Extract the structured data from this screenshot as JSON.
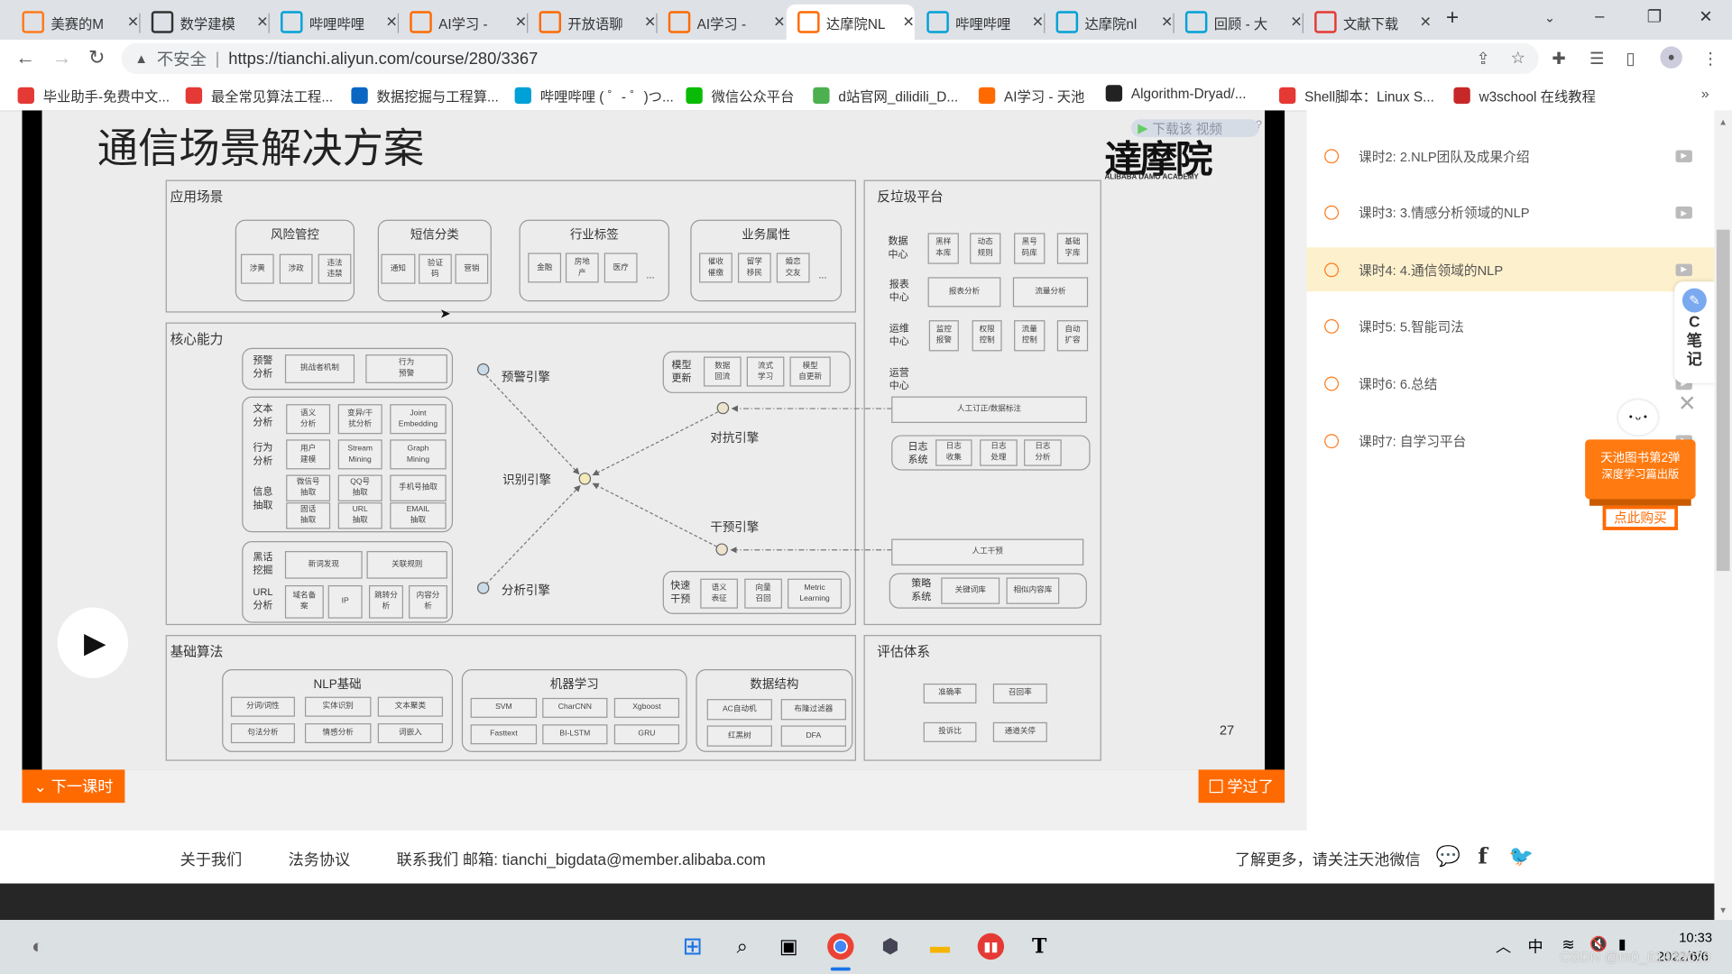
{
  "tabs": [
    {
      "label": "美赛的M",
      "icon": "sogou-icon",
      "color": "#ff7a1a"
    },
    {
      "label": "数学建模",
      "icon": "zhihu-like-icon",
      "color": "#333333"
    },
    {
      "label": "哔哩哔哩",
      "icon": "bilibili-icon",
      "color": "#00a1d6"
    },
    {
      "label": "AI学习 -",
      "icon": "aliyun-icon",
      "color": "#ff6a00"
    },
    {
      "label": "开放语聊",
      "icon": "aliyun-icon",
      "color": "#ff6a00"
    },
    {
      "label": "AI学习 -",
      "icon": "aliyun-icon",
      "color": "#ff6a00"
    },
    {
      "label": "达摩院NL",
      "icon": "aliyun-icon",
      "color": "#ff6a00",
      "active": true
    },
    {
      "label": "哔哩哔哩",
      "icon": "bilibili-icon",
      "color": "#00a1d6"
    },
    {
      "label": "达摩院nl",
      "icon": "bilibili-icon",
      "color": "#00a1d6"
    },
    {
      "label": "回顾 - 大",
      "icon": "bilibili-icon",
      "color": "#00a1d6"
    },
    {
      "label": "文献下载",
      "icon": "wenxian-icon",
      "color": "#e53935"
    }
  ],
  "address": {
    "security": "不安全",
    "url": "https://tianchi.aliyun.com/course/280/3367"
  },
  "bookmarks": [
    {
      "label": "毕业助手-免费中文...",
      "color": "#e53935"
    },
    {
      "label": "最全常见算法工程...",
      "color": "#e53935"
    },
    {
      "label": "数据挖掘与工程算...",
      "color": "#0a66c2"
    },
    {
      "label": "哔哩哔哩 ( ゜- ゜)つ...",
      "color": "#00a1d6"
    },
    {
      "label": "微信公众平台",
      "color": "#09bb07"
    },
    {
      "label": "d站官网_dilidili_D...",
      "color": "#4caf50"
    },
    {
      "label": "AI学习 - 天池",
      "color": "#ff6a00"
    },
    {
      "label": "Algorithm-Dryad/...",
      "color": "#222222"
    },
    {
      "label": "Shell脚本：Linux S...",
      "color": "#e53935"
    },
    {
      "label": "w3school 在线教程",
      "color": "#c62828"
    }
  ],
  "slide": {
    "title": "通信场景解决方案",
    "logo": "達摩院",
    "logo_sub": "ALIBABA DAMO ACADEMY",
    "download_overlay": "下载该 视频",
    "page_number": "27",
    "app": {
      "title": "应用场景",
      "ellipsis": "...",
      "groups": [
        {
          "title": "风险管控",
          "items": [
            "涉黄",
            "涉政",
            "违法\n违禁"
          ]
        },
        {
          "title": "短信分类",
          "items": [
            "通知",
            "验证\n码",
            "营销"
          ]
        },
        {
          "title": "行业标签",
          "items": [
            "金融",
            "房地\n产",
            "医疗"
          ]
        },
        {
          "title": "业务属性",
          "items": [
            "催收\n催缴",
            "留学\n移民",
            "婚恋\n交友"
          ]
        }
      ]
    },
    "core": {
      "title": "核心能力",
      "warn": {
        "label": "预警\n分析",
        "items": [
          "挑战者机制",
          "行为\n预警"
        ]
      },
      "text": {
        "label": "文本\n分析",
        "items": [
          "语义\n分析",
          "变异/干\n扰分析",
          "Joint\nEmbedding"
        ]
      },
      "behavior": {
        "label": "行为\n分析",
        "items": [
          "用户\n建模",
          "Stream\nMining",
          "Graph\nMining"
        ]
      },
      "extract": {
        "label": "信息\n抽取",
        "items": [
          "微信号\n抽取",
          "QQ号\n抽取",
          "手机号抽取",
          "固话\n抽取",
          "URL\n抽取",
          "EMAIL\n抽取"
        ]
      },
      "slang": {
        "label": "黑话\n挖掘",
        "items": [
          "新词发现",
          "关联规则"
        ]
      },
      "url": {
        "label": "URL\n分析",
        "items": [
          "域名备\n案",
          "IP",
          "跳转分\n析",
          "内容分\n析"
        ]
      },
      "engines": {
        "warning": "预警引擎",
        "identify": "识别引擎",
        "analysis": "分析引擎",
        "adversarial": "对抗引擎",
        "intervention": "干预引擎"
      },
      "model_update": {
        "label": "模型\n更新",
        "items": [
          "数据\n回流",
          "流式\n学习",
          "模型\n自更新"
        ]
      },
      "fast": {
        "label": "快速\n干预",
        "items": [
          "语义\n表征",
          "向量\n召回",
          "Metric\nLearning"
        ]
      }
    },
    "anti": {
      "title": "反垃圾平台",
      "data_center": {
        "label": "数据\n中心",
        "items": [
          "黑样\n本库",
          "动态\n规则",
          "黑号\n码库",
          "基础\n字库"
        ]
      },
      "report_center": {
        "label": "报表\n中心",
        "items": [
          "报表分析",
          "流量分析"
        ]
      },
      "ops_center": {
        "label": "运维\n中心",
        "items": [
          "监控\n报警",
          "权限\n控制",
          "流量\n控制",
          "自动\n扩容"
        ]
      },
      "operation_center": {
        "label": "运营\n中心"
      },
      "annotate": "人工订正/数据标注",
      "log": {
        "label": "日志\n系统",
        "items": [
          "日志\n收集",
          "日志\n处理",
          "日志\n分析"
        ]
      },
      "manual": "人工干预",
      "strategy": {
        "label": "策略\n系统",
        "items": [
          "关键词库",
          "相似内容库"
        ]
      }
    },
    "algo": {
      "title": "基础算法",
      "groups": [
        {
          "title": "NLP基础",
          "items": [
            "分词/词性",
            "实体识别",
            "文本聚类",
            "句法分析",
            "情感分析",
            "词嵌入"
          ]
        },
        {
          "title": "机器学习",
          "items": [
            "SVM",
            "CharCNN",
            "Xgboost",
            "Fasttext",
            "BI-LSTM",
            "GRU"
          ]
        },
        {
          "title": "数据结构",
          "items": [
            "AC自动机",
            "布隆过滤器",
            "红黑树",
            "DFA"
          ]
        }
      ]
    },
    "eval": {
      "title": "评估体系",
      "items": [
        "准确率",
        "召回率",
        "投诉比",
        "通道关停"
      ]
    }
  },
  "player": {
    "next_label": "下一课时",
    "learned_label": "学过了"
  },
  "lessons": [
    {
      "label": "课时2: 2.NLP团队及成果介绍",
      "active": false
    },
    {
      "label": "课时3: 3.情感分析领域的NLP",
      "active": false
    },
    {
      "label": "课时4: 4.通信领域的NLP",
      "active": true
    },
    {
      "label": "课时5: 5.智能司法",
      "active": false
    },
    {
      "label": "课时6: 6.总结",
      "active": false
    },
    {
      "label": "课时7: 自学习平台",
      "active": false
    }
  ],
  "notes_widget": {
    "label": "C\n笔\n记"
  },
  "promo": {
    "line1": "天池图书第2弹",
    "line2": "深度学习篇出版",
    "button": "点此购买"
  },
  "footer": {
    "about": "关于我们",
    "legal": "法务协议",
    "contact": "联系我们 邮箱: tianchi_bigdata@member.alibaba.com",
    "follow": "了解更多，请关注天池微信"
  },
  "taskbar": {
    "ime": "中",
    "time": "10:33",
    "date": "2022/6/6",
    "watermark": "CSDN @m0_61938029"
  },
  "colors": {
    "accent": "#ff6a00",
    "highlight": "#fdf0cc"
  }
}
